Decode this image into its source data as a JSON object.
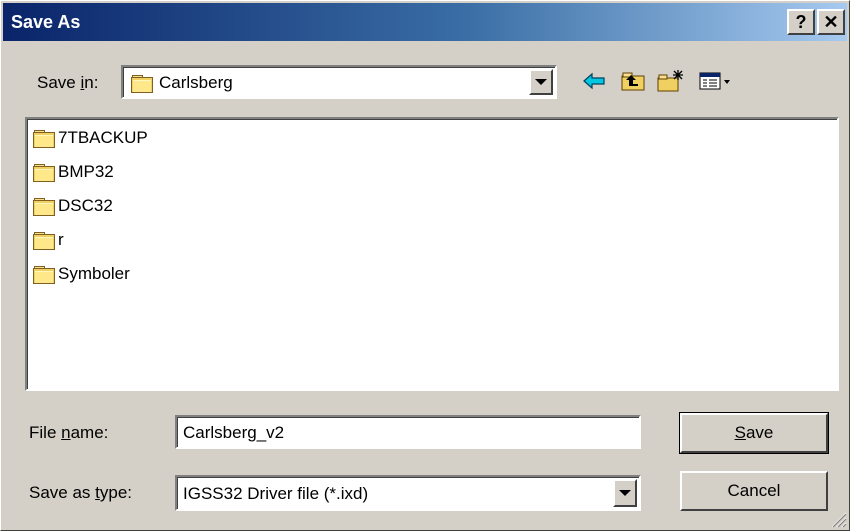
{
  "window": {
    "title": "Save As"
  },
  "titlebar": {
    "help_label": "?",
    "close_label": "✕"
  },
  "save_in": {
    "label_pre": "Save ",
    "label_ul": "i",
    "label_post": "n:",
    "value": "Carlsberg"
  },
  "toolbar": {
    "back": "back-icon",
    "up": "up-folder-icon",
    "new_folder": "new-folder-icon",
    "view_menu": "view-menu-icon"
  },
  "files": [
    {
      "name": "7TBACKUP"
    },
    {
      "name": "BMP32"
    },
    {
      "name": "DSC32"
    },
    {
      "name": "r"
    },
    {
      "name": "Symboler"
    }
  ],
  "file_name": {
    "label_pre": "File ",
    "label_ul": "n",
    "label_post": "ame:",
    "value": "Carlsberg_v2"
  },
  "save_as_type": {
    "label_pre": "Save as ",
    "label_ul": "t",
    "label_post": "ype:",
    "value": "IGSS32 Driver file (*.ixd)"
  },
  "buttons": {
    "save_ul": "S",
    "save_rest": "ave",
    "cancel": "Cancel"
  }
}
